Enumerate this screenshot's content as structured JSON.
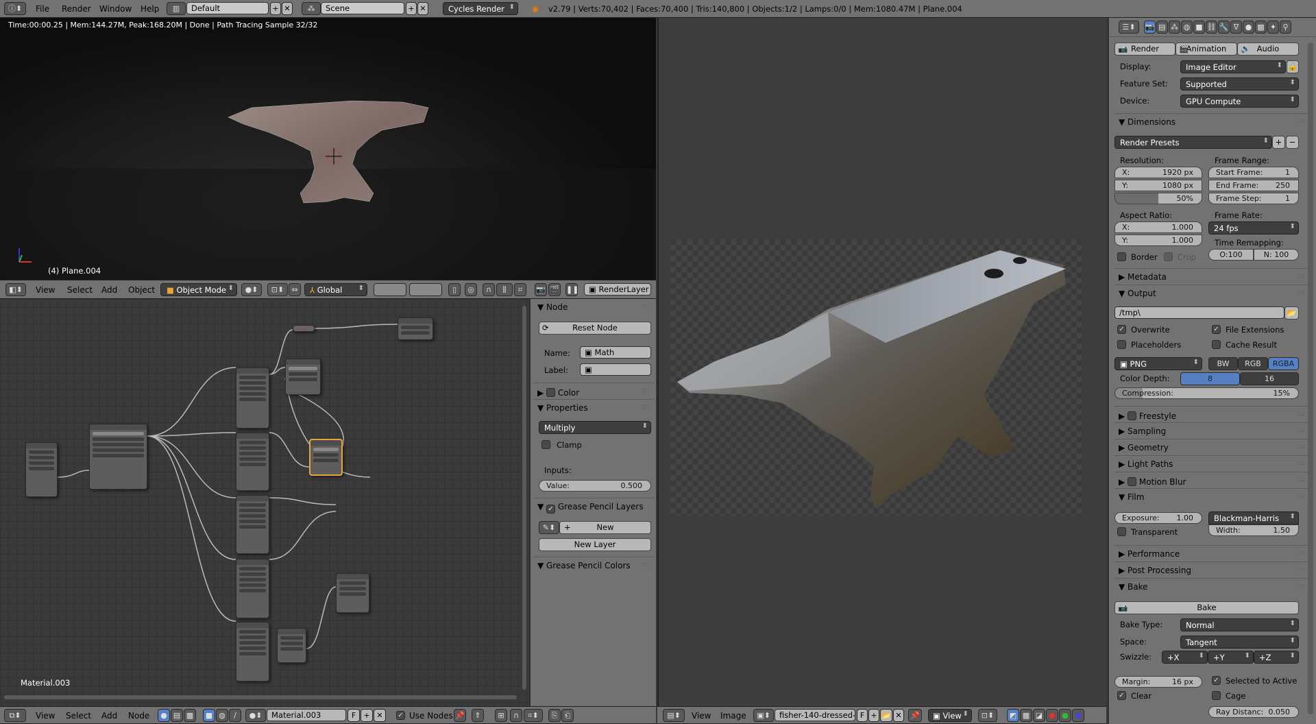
{
  "top_bar": {
    "menus": [
      "File",
      "Render",
      "Window",
      "Help"
    ],
    "layout": "Default",
    "scene": "Scene",
    "engine": "Cycles Render",
    "stats": "v2.79 | Verts:70,402 | Faces:70,400 | Tris:140,800 | Objects:1/2 | Lamps:0/0 | Mem:1080.47M | Plane.004"
  },
  "viewport": {
    "render_info": "Time:00:00.25 | Mem:144.27M, Peak:168.20M | Done | Path Tracing Sample 32/32",
    "object_label": "(4) Plane.004",
    "header": {
      "menus": [
        "View",
        "Select",
        "Add",
        "Object"
      ],
      "mode": "Object Mode",
      "orientation": "Global",
      "render_layer": "RenderLayer"
    }
  },
  "node_editor": {
    "material_label": "Material.003",
    "header": {
      "menus": [
        "View",
        "Select",
        "Add",
        "Node"
      ],
      "material": "Material.003",
      "fake_user": "F",
      "use_nodes": "Use Nodes",
      "use_nodes_checked": true
    },
    "sidebar": {
      "node_section": "Node",
      "reset_node": "Reset Node",
      "name_label": "Name:",
      "name_value": "Math",
      "label_label": "Label:",
      "label_value": "",
      "color_section": "Color",
      "properties_section": "Properties",
      "operation": "Multiply",
      "clamp": "Clamp",
      "inputs_label": "Inputs:",
      "value_label": "Value:",
      "value": "0.500",
      "gp_layers_section": "Grease Pencil Layers",
      "gp_new": "New",
      "gp_new_layer": "New Layer",
      "gp_colors_section": "Grease Pencil Colors"
    }
  },
  "image_editor": {
    "header": {
      "menus": [
        "View",
        "Image"
      ],
      "image_name": "fisher-140-dressed-s...",
      "fake_user": "F",
      "view_mode": "View"
    }
  },
  "properties": {
    "tabs": [
      "Render",
      "Animation",
      "Audio"
    ],
    "display_label": "Display:",
    "display": "Image Editor",
    "feature_set_label": "Feature Set:",
    "feature_set": "Supported",
    "device_label": "Device:",
    "device": "GPU Compute",
    "dimensions": {
      "title": "Dimensions",
      "presets": "Render Presets",
      "resolution_label": "Resolution:",
      "res_x_label": "X:",
      "res_x": "1920 px",
      "res_y_label": "Y:",
      "res_y": "1080 px",
      "res_pct": "50%",
      "res_pct_value": 50,
      "frame_range_label": "Frame Range:",
      "start_label": "Start Frame:",
      "start": "1",
      "end_label": "End Frame:",
      "end": "250",
      "step_label": "Frame Step:",
      "step": "1",
      "aspect_label": "Aspect Ratio:",
      "asp_x_label": "X:",
      "asp_x": "1.000",
      "asp_y_label": "Y:",
      "asp_y": "1.000",
      "frame_rate_label": "Frame Rate:",
      "frame_rate": "24 fps",
      "time_remap_label": "Time Remapping:",
      "remap_old": "O:100",
      "remap_new": "N: 100",
      "border": "Border",
      "crop": "Crop"
    },
    "metadata": "Metadata",
    "output": {
      "title": "Output",
      "path": "/tmp\\",
      "overwrite": "Overwrite",
      "file_extensions": "File Extensions",
      "placeholders": "Placeholders",
      "cache_result": "Cache Result",
      "format": "PNG",
      "color_modes": [
        "BW",
        "RGB",
        "RGBA"
      ],
      "color_mode_selected": "RGBA",
      "color_depth_label": "Color Depth:",
      "depths": [
        "8",
        "16"
      ],
      "depth_selected": "8",
      "compression_label": "Compression:",
      "compression": "15%",
      "compression_value": 15
    },
    "collapsed": [
      "Freestyle",
      "Sampling",
      "Geometry",
      "Light Paths",
      "Motion Blur"
    ],
    "film": {
      "title": "Film",
      "exposure_label": "Exposure:",
      "exposure": "1.00",
      "transparent": "Transparent",
      "filter": "Blackman-Harris",
      "width_label": "Width:",
      "width": "1.50"
    },
    "collapsed2": [
      "Performance",
      "Post Processing"
    ],
    "bake": {
      "title": "Bake",
      "button": "Bake",
      "type_label": "Bake Type:",
      "type": "Normal",
      "space_label": "Space:",
      "space": "Tangent",
      "swizzle_label": "Swizzle:",
      "swizzle": [
        "+X",
        "+Y",
        "+Z"
      ],
      "margin_label": "Margin:",
      "margin": "16 px",
      "selected_to_active": "Selected to Active",
      "clear": "Clear",
      "cage": "Cage",
      "ray_label": "Ray Distanc:",
      "ray": "0.050"
    }
  },
  "colors": {
    "accent_blue": "#5680c2",
    "selected_node": "#e8a33c",
    "header": "#727272"
  }
}
